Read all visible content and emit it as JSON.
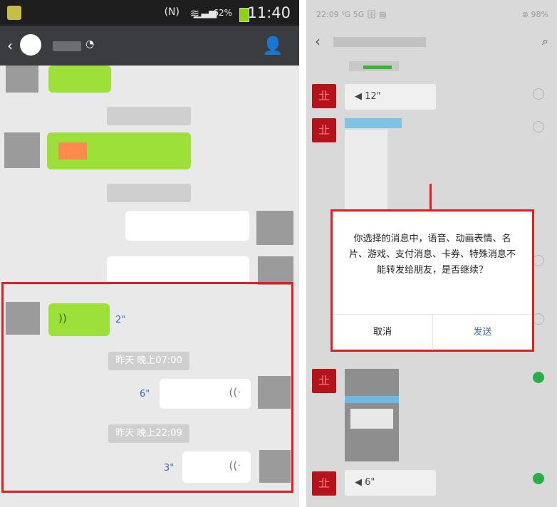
{
  "left": {
    "status": {
      "time": "11:40",
      "battery": "62%"
    },
    "voice_sent": {
      "duration": "2\""
    },
    "voice_recv_1": {
      "duration": "6\""
    },
    "voice_recv_2": {
      "duration": "3\""
    },
    "timestamp_1": "昨天 晚上07:00",
    "timestamp_2": "昨天 晚上22:09"
  },
  "right": {
    "status": {
      "left": "22:09 ⁵G 5G 🗄 ▤",
      "right": "⊗ 98%"
    },
    "voice_1": "◀ 12\"",
    "voice_2": "◀ 6\"",
    "dialog": {
      "message": "你选择的消息中，语音、动画表情、名片、游戏、支付消息、卡券、特殊消息不能转发给朋友，是否继续？",
      "cancel": "取消",
      "send": "发送"
    }
  }
}
